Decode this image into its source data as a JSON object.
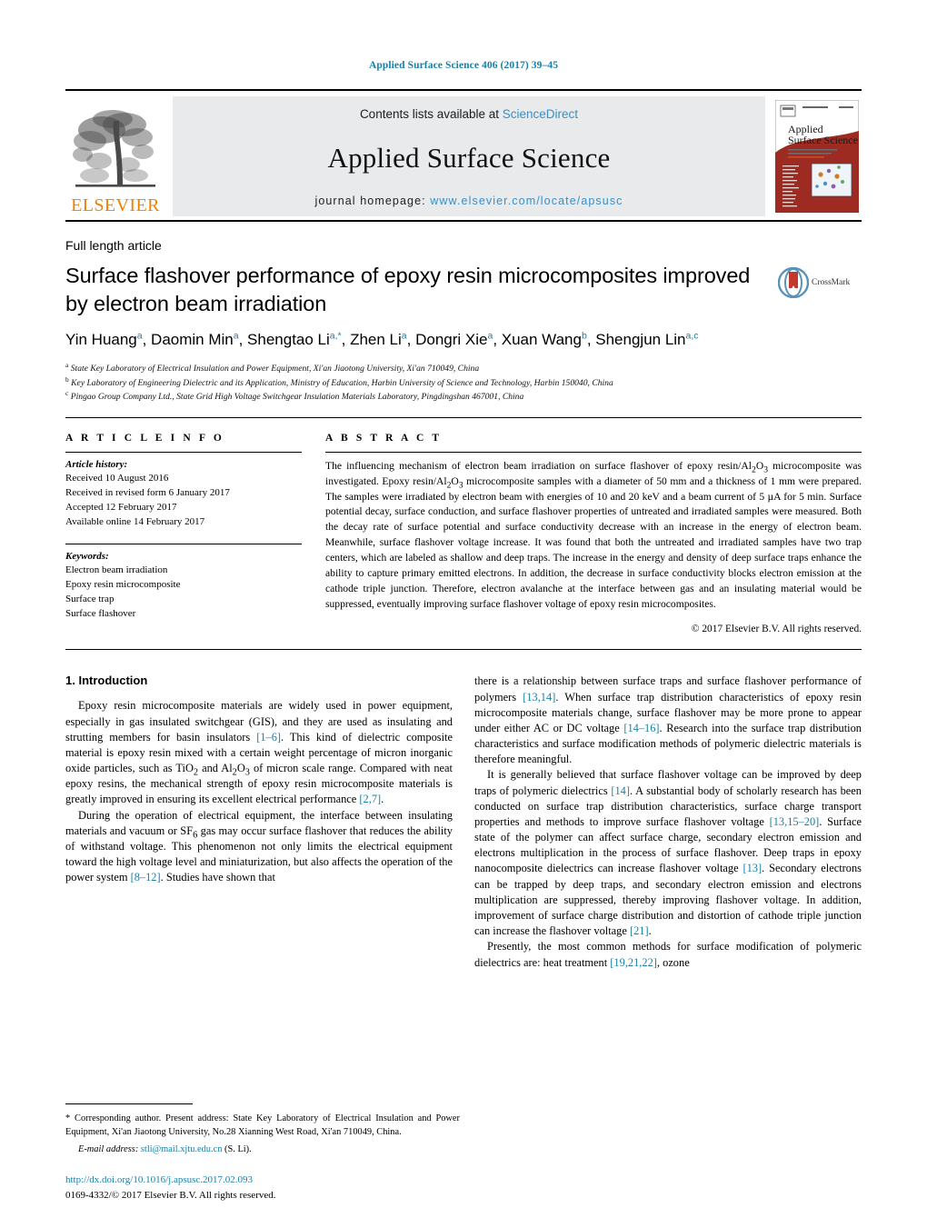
{
  "running_head": "Applied Surface Science 406 (2017) 39–45",
  "masthead": {
    "contents_prefix": "Contents lists available at ",
    "sciencedirect": "ScienceDirect",
    "journal_title": "Applied Surface Science",
    "homepage_prefix": "journal homepage: ",
    "homepage_url": "www.elsevier.com/locate/apsusc",
    "publisher_word": "ELSEVIER",
    "cover_title_line1": "Applied",
    "cover_title_line2": "Surface Science",
    "accent_orange": "#f08000",
    "link_blue": "#3a8fc4"
  },
  "article": {
    "type_label": "Full length article",
    "title": "Surface flashover performance of epoxy resin microcomposites improved by electron beam irradiation",
    "crossmark_label": "CrossMark",
    "authors_html": "Yin Huang<sup>a</sup>, Daomin Min<sup>a</sup>, Shengtao Li<sup>a,*</sup>, Zhen Li<sup>a</sup>, Dongri Xie<sup>a</sup>, Xuan Wang<sup>b</sup>, Shengjun Lin<sup>a,c</sup>",
    "affiliations": [
      "State Key Laboratory of Electrical Insulation and Power Equipment, Xi'an Jiaotong University, Xi'an 710049, China",
      "Key Laboratory of Engineering Dielectric and its Application, Ministry of Education, Harbin University of Science and Technology, Harbin 150040, China",
      "Pingao Group Company Ltd., State Grid High Voltage Switchgear Insulation Materials Laboratory, Pingdingshan 467001, China"
    ],
    "affiliation_marks": [
      "a",
      "b",
      "c"
    ]
  },
  "article_info": {
    "heading": "A R T I C L E   I N F O",
    "history_label": "Article history:",
    "history": [
      "Received 10 August 2016",
      "Received in revised form 6 January 2017",
      "Accepted 12 February 2017",
      "Available online 14 February 2017"
    ],
    "keywords_label": "Keywords:",
    "keywords": [
      "Electron beam irradiation",
      "Epoxy resin microcomposite",
      "Surface trap",
      "Surface flashover"
    ]
  },
  "abstract": {
    "heading": "A B S T R A C T",
    "text_html": "The influencing mechanism of electron beam irradiation on surface flashover of epoxy resin/Al<sub>2</sub>O<sub>3</sub> microcomposite was investigated. Epoxy resin/Al<sub>2</sub>O<sub>3</sub> microcomposite samples with a diameter of 50 mm and a thickness of 1 mm were prepared. The samples were irradiated by electron beam with energies of 10 and 20 keV and a beam current of 5 &#181;A for 5 min. Surface potential decay, surface conduction, and surface flashover properties of untreated and irradiated samples were measured. Both the decay rate of surface potential and surface conductivity decrease with an increase in the energy of electron beam. Meanwhile, surface flashover voltage increase. It was found that both the untreated and irradiated samples have two trap centers, which are labeled as shallow and deep traps. The increase in the energy and density of deep surface traps enhance the ability to capture primary emitted electrons. In addition, the decrease in surface conductivity blocks electron emission at the cathode triple junction. Therefore, electron avalanche at the interface between gas and an insulating material would be suppressed, eventually improving surface flashover voltage of epoxy resin microcomposites.",
    "copyright": "© 2017 Elsevier B.V. All rights reserved."
  },
  "body": {
    "section_heading": "1.  Introduction",
    "left_paragraphs_html": [
      "Epoxy resin microcomposite materials are widely used in power equipment, especially in gas insulated switchgear (GIS), and they are used as insulating and strutting members for basin insulators <span class=\"ref\">[1–6]</span>. This kind of dielectric composite material is epoxy resin mixed with a certain weight percentage of micron inorganic oxide particles, such as TiO<sub>2</sub> and Al<sub>2</sub>O<sub>3</sub> of micron scale range. Compared with neat epoxy resins, the mechanical strength of epoxy resin microcomposite materials is greatly improved in ensuring its excellent electrical performance <span class=\"ref\">[2,7]</span>.",
      "During the operation of electrical equipment, the interface between insulating materials and vacuum or SF<sub>6</sub> gas may occur surface flashover that reduces the ability of withstand voltage. This phenomenon not only limits the electrical equipment toward the high voltage level and miniaturization, but also affects the operation of the power system <span class=\"ref\">[8–12]</span>. Studies have shown that"
    ],
    "right_paragraphs_html": [
      "there is a relationship between surface traps and surface flashover performance of polymers <span class=\"ref\">[13,14]</span>. When surface trap distribution characteristics of epoxy resin microcomposite materials change, surface flashover may be more prone to appear under either AC or DC voltage <span class=\"ref\">[14–16]</span>. Research into the surface trap distribution characteristics and surface modification methods of polymeric dielectric materials is therefore meaningful.",
      "It is generally believed that surface flashover voltage can be improved by deep traps of polymeric dielectrics <span class=\"ref\">[14]</span>. A substantial body of scholarly research has been conducted on surface trap distribution characteristics, surface charge transport properties and methods to improve surface flashover voltage <span class=\"ref\">[13,15–20]</span>. Surface state of the polymer can affect surface charge, secondary electron emission and electrons multiplication in the process of surface flashover. Deep traps in epoxy nanocomposite dielectrics can increase flashover voltage <span class=\"ref\">[13]</span>. Secondary electrons can be trapped by deep traps, and secondary electron emission and electrons multiplication are suppressed, thereby improving flashover voltage. In addition, improvement of surface charge distribution and distortion of cathode triple junction can increase the flashover voltage <span class=\"ref\">[21]</span>.",
      "Presently, the most common methods for surface modification of polymeric dielectrics are: heat treatment <span class=\"ref\">[19,21,22]</span>, ozone"
    ]
  },
  "footnotes": {
    "corresponding_html": "<span class=\"star\">*</span>  Corresponding author. Present address: State Key Laboratory of Electrical Insulation and Power Equipment, Xi'an Jiaotong University, No.28 Xianning West Road, Xi'an 710049, China.",
    "email_label": "E-mail address:",
    "email": "stli@mail.xjtu.edu.cn",
    "email_suffix": "(S. Li).",
    "doi": "http://dx.doi.org/10.1016/j.apsusc.2017.02.093",
    "issn_line": "0169-4332/© 2017 Elsevier B.V. All rights reserved."
  }
}
